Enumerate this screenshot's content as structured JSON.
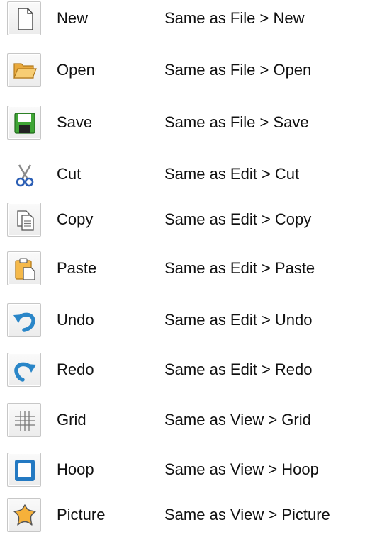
{
  "rows": [
    {
      "icon": "new-document-icon",
      "name": "New",
      "description": "Same as File > New"
    },
    {
      "icon": "open-folder-icon",
      "name": "Open",
      "description": "Same as File > Open"
    },
    {
      "icon": "save-disk-icon",
      "name": "Save",
      "description": "Same as File > Save"
    },
    {
      "icon": "scissors-icon",
      "name": "Cut",
      "description": "Same as Edit > Cut"
    },
    {
      "icon": "copy-icon",
      "name": "Copy",
      "description": "Same as Edit > Copy"
    },
    {
      "icon": "paste-clipboard-icon",
      "name": "Paste",
      "description": "Same as Edit > Paste"
    },
    {
      "icon": "undo-arrow-icon",
      "name": "Undo",
      "description": "Same as Edit > Undo"
    },
    {
      "icon": "redo-arrow-icon",
      "name": "Redo",
      "description": "Same as Edit > Redo"
    },
    {
      "icon": "grid-icon",
      "name": "Grid",
      "description": "Same as View > Grid"
    },
    {
      "icon": "hoop-icon",
      "name": "Hoop",
      "description": "Same as View > Hoop"
    },
    {
      "icon": "picture-star-icon",
      "name": "Picture",
      "description": "Same as View > Picture"
    }
  ],
  "colors": {
    "folder": "#f3c56a",
    "save_green": "#3fa535",
    "scissors_blue": "#2c5fb5",
    "arrow_blue": "#2a86c8",
    "hoop_blue": "#2379c2",
    "star_orange": "#f6b13a"
  }
}
